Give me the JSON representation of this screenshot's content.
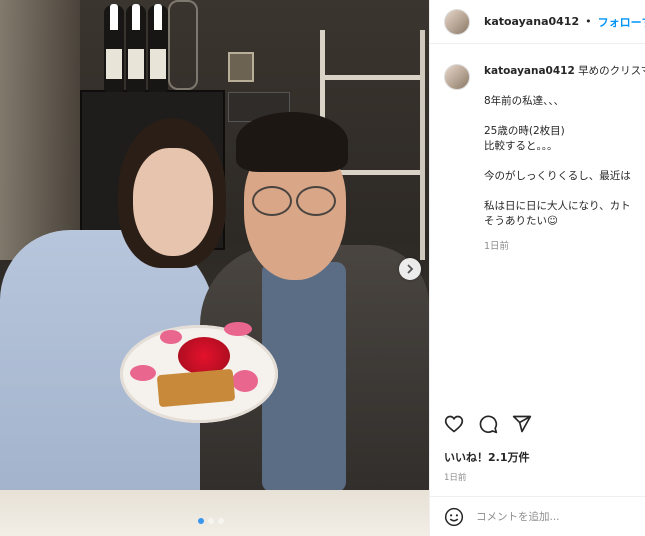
{
  "post": {
    "username": "katoayana0412",
    "separator": "•",
    "follow_label": "フォローする",
    "caption_lines": [
      "早めのクリスマ",
      "",
      "8年前の私達、、、",
      "",
      "25歳の時(2枚目)",
      "比較すると。。。",
      "",
      "今のがしっくりくるし、最近は",
      "",
      "私は日に日に大人になり、カト",
      "そうありたい☺"
    ],
    "caption_time": "1日前",
    "likes_text": "いいね！2.1万件",
    "date_text": "1日前",
    "comment_placeholder": "コメントを追加...",
    "carousel": {
      "slides": 3,
      "active": 1
    }
  },
  "icons": [
    "heart-icon",
    "comment-icon",
    "share-icon",
    "emoji-icon",
    "chevron-right-icon"
  ]
}
